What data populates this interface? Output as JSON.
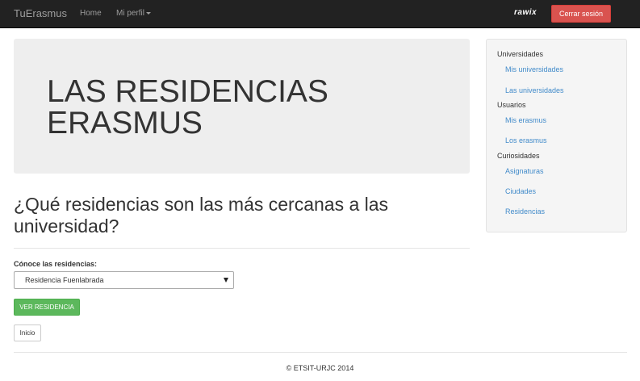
{
  "navbar": {
    "brand": "TuErasmus",
    "home": "Home",
    "profile": "Mi perfil",
    "username": "rawix",
    "logout": "Cerrar sesión"
  },
  "jumbotron": {
    "title": "LAS RESIDENCIAS ERASMUS"
  },
  "main": {
    "question": "¿Qué residencias son las más cercanas a las universidad?",
    "select_label": "Cónoce las residencias:",
    "select_value": "Residencia Fuenlabrada",
    "view_button": "VER RESIDENCIA",
    "home_button": "Inicio"
  },
  "sidebar": {
    "sections": [
      {
        "header": "Universidades",
        "links": [
          "Mis universidades",
          "Las universidades"
        ]
      },
      {
        "header": "Usuarios",
        "links": [
          "Mis erasmus",
          "Los erasmus"
        ]
      },
      {
        "header": "Curiosidades",
        "links": [
          "Asignaturas",
          "Ciudades",
          "Residencias"
        ]
      }
    ]
  },
  "footer": {
    "text": "© ETSIT-URJC 2014"
  },
  "colors": {
    "navbar_bg": "#222222",
    "danger": "#d9534f",
    "success": "#5cb85c",
    "link": "#428bca",
    "jumbotron_bg": "#eeeeee"
  }
}
